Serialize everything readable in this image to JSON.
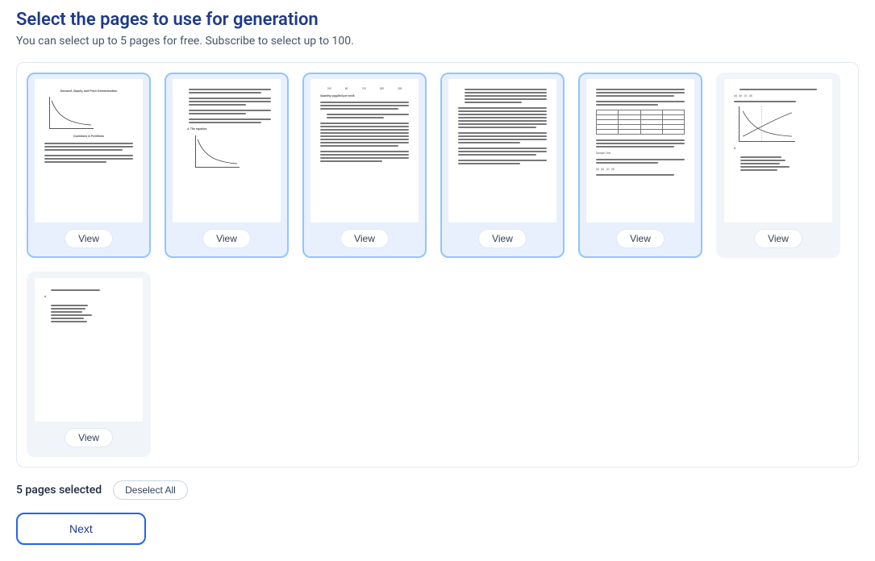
{
  "title": "Select the pages to use for generation",
  "subtitle": "You can select up to 5 pages for free. Subscribe to select up to 100.",
  "view_label": "View",
  "selected_text": "5 pages selected",
  "deselect_label": "Deselect All",
  "next_label": "Next",
  "pages": [
    {
      "selected": true
    },
    {
      "selected": true
    },
    {
      "selected": true
    },
    {
      "selected": true
    },
    {
      "selected": true
    },
    {
      "selected": false
    },
    {
      "selected": false
    }
  ]
}
